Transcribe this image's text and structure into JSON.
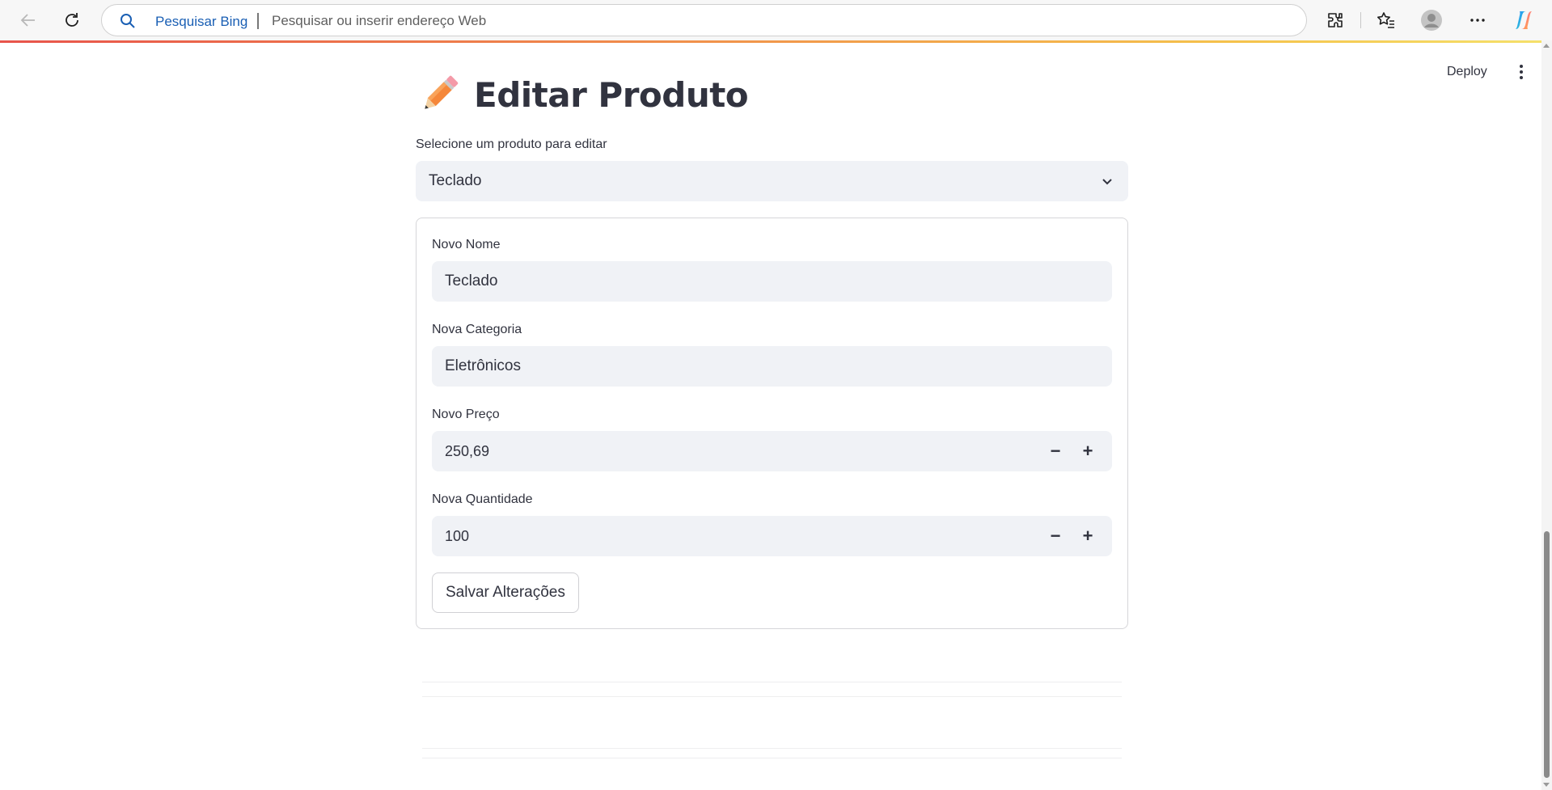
{
  "browser": {
    "search_engine_label": "Pesquisar Bing",
    "address_placeholder": "Pesquisar ou inserir endereço Web",
    "icons": [
      "back-arrow-icon",
      "refresh-icon",
      "search-icon",
      "extensions-icon",
      "favorites-icon",
      "profile-icon",
      "more-icon",
      "copilot-icon"
    ]
  },
  "header": {
    "deploy_label": "Deploy"
  },
  "page": {
    "title": "Editar Produto",
    "title_icon": "pencil-icon"
  },
  "select_product": {
    "label": "Selecione um produto para editar",
    "selected": "Teclado"
  },
  "form": {
    "name": {
      "label": "Novo Nome",
      "value": "Teclado"
    },
    "category": {
      "label": "Nova Categoria",
      "value": "Eletrônicos"
    },
    "price": {
      "label": "Novo Preço",
      "value": "250,69",
      "minus": "−",
      "plus": "+"
    },
    "quantity": {
      "label": "Nova Quantidade",
      "value": "100",
      "minus": "−",
      "plus": "+"
    },
    "submit_label": "Salvar Alterações"
  },
  "colors": {
    "accent_blue": "#1a5fb4",
    "input_bg": "#f0f2f6",
    "text": "#31333f"
  }
}
